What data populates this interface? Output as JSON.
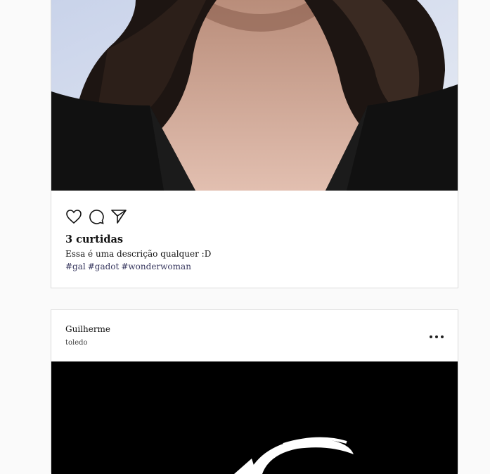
{
  "posts": [
    {
      "image_alt": "portrait photo",
      "likes_text": "3 curtidas",
      "caption": "Essa é uma descrição qualquer :D",
      "tags": [
        "#gal",
        "#gadot",
        "#wonderwoman"
      ]
    },
    {
      "username": "Guilherme",
      "location": "toledo",
      "image_alt": "logo photo"
    }
  ],
  "icons": {
    "like": "heart-icon",
    "comment": "comment-icon",
    "share": "send-icon",
    "more": "more-options-icon"
  }
}
